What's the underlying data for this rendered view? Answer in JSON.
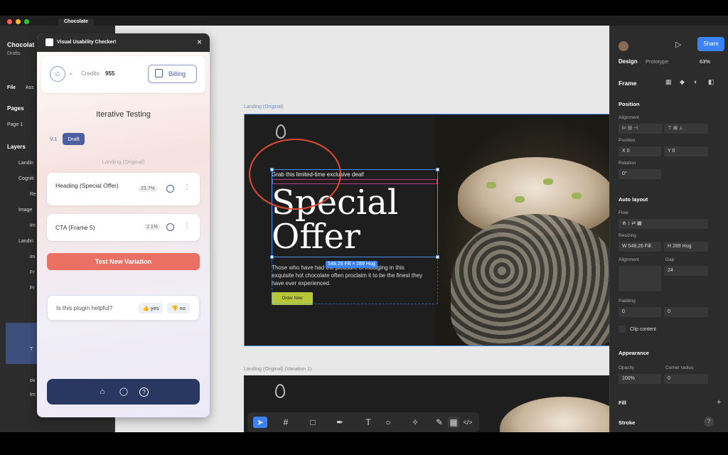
{
  "window": {
    "tab_title": "Chocolate",
    "file_name": "Chocolat",
    "project": "Drafts"
  },
  "left_panel": {
    "tabs": [
      "File",
      "Ass"
    ],
    "pages_label": "Pages",
    "current_page": "Page 1",
    "layers_label": "Layers",
    "layers": [
      "Landin",
      "Cogniti",
      "Re",
      "Image",
      "Im",
      "Landin",
      "im",
      "Fr",
      "Fr",
      "T",
      "ov",
      "Im"
    ]
  },
  "canvas": {
    "frame1_label": "Landing (Original)",
    "frame2_label": "Landing (Original) (Variation 1)",
    "landing": {
      "tagline": "Grab this limited-time exclusive deal!",
      "title_line1": "Special",
      "title_line2": "Offer",
      "body": "Those who have had the pleasure of indulging in this exquisite hot chocolate often proclaim it to be the finest they have ever experienced.",
      "cta": "Order Now"
    },
    "size_badge": "548.26 Fill × 289 Hug"
  },
  "toolbar": {
    "tools": [
      "move-tool",
      "frame-tool",
      "shape-tool",
      "pen-tool",
      "text-tool",
      "comment-tool",
      "actions-tool",
      "dev-mode-a",
      "dev-mode-b",
      "code-view"
    ]
  },
  "right_panel": {
    "tabs": [
      "Design",
      "Prototype"
    ],
    "zoom": "63%",
    "share_label": "Share",
    "frame_label": "Frame",
    "position_label": "Position",
    "alignment_label": "Alignment",
    "position_sub": "Position",
    "x_value": "X 0",
    "y_value": "Y 0",
    "rotation_label": "Rotation",
    "rotation_value": "0°",
    "auto_layout_label": "Auto layout",
    "flow_label": "Flow",
    "resizing_label": "Resizing",
    "width_value": "W 548.26",
    "width_mode": "Fill",
    "height_value": "H 289",
    "height_mode": "Hug",
    "alignment2_label": "Alignment",
    "gap_label": "Gap",
    "gap_value": "24",
    "padding_label": "Padding",
    "padding_h": "0",
    "padding_v": "0",
    "clip_content": "Clip content",
    "appearance_label": "Appearance",
    "opacity_label": "Opacity",
    "opacity_value": "100%",
    "corner_label": "Corner radius",
    "corner_value": "0",
    "fill_label": "Fill",
    "stroke_label": "Stroke"
  },
  "plugin": {
    "title": "Visual Usability Checker!",
    "credits_label": "Credits:",
    "credits_value": "955",
    "billing_label": "Billing",
    "section_title": "Iterative Testing",
    "version": "V.1",
    "draft_label": "Draft",
    "frame_name": "Landing (Original)",
    "items": [
      {
        "label": "Heading (Special Offer)",
        "pct": "23.7%"
      },
      {
        "label": "CTA (Frame 5)",
        "pct": "2.1%"
      }
    ],
    "test_button": "Test New Variation",
    "helpful_question": "Is this plugin helpful?",
    "yes_label": "yes",
    "no_label": "no"
  },
  "colors": {
    "accent": "#3b82f6",
    "plugin_primary": "#ea7064",
    "plugin_footer": "#283860",
    "cta_green": "#b7c73a",
    "annotation_red": "#e24a32"
  }
}
